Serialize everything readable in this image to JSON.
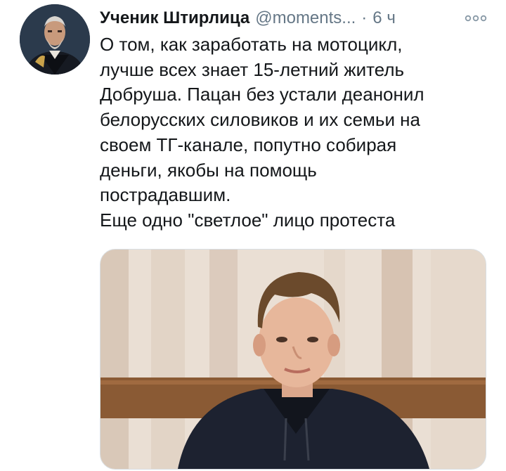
{
  "tweet": {
    "author_name": "Ученик Штирлица",
    "handle": "@moments...",
    "separator": "·",
    "time": "6 ч",
    "text_lines": [
      "О том, как заработать на мотоцикл,",
      "лучше всех знает 15-летний житель",
      "Добруша. Пацан без устали деанонил",
      "белорусских силовиков и их семьи на",
      "своем ТГ-канале, попутно собирая",
      "деньги, якобы на помощь",
      "пострадавшим.",
      "Еще одно \"светлое\" лицо протеста"
    ]
  },
  "icons": {
    "avatar": "portrait-avatar",
    "more": "more-options-icon"
  },
  "colors": {
    "text": "#14171a",
    "secondary": "#657786"
  }
}
